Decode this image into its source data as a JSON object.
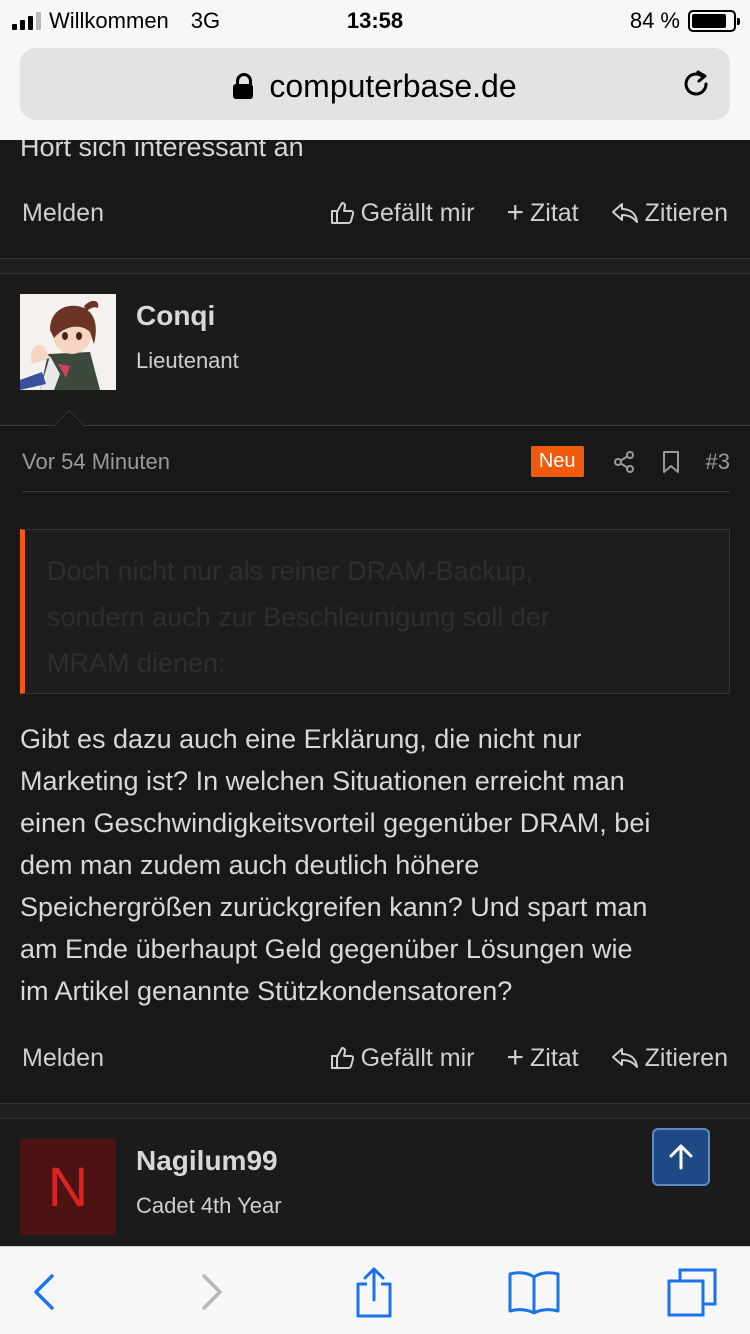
{
  "status_bar": {
    "carrier": "Willkommen",
    "network": "3G",
    "time": "13:58",
    "battery_text": "84 %",
    "battery_level": 0.84
  },
  "browser": {
    "url": "computerbase.de"
  },
  "previous_post": {
    "text_tail": "Hört sich interessant an",
    "actions": {
      "report": "Melden",
      "like": "Gefällt mir",
      "quote": "Zitat",
      "reply": "Zitieren"
    }
  },
  "post": {
    "author": "Conqi",
    "rank": "Lieutenant",
    "time": "Vor 54 Minuten",
    "badge": "Neu",
    "number": "#3",
    "quote_lines": [
      "Doch nicht nur als reiner DRAM-Backup,",
      "sondern auch zur Beschleunigung soll der",
      "MRAM dienen:"
    ],
    "body_lines": [
      "Gibt es dazu auch eine Erklärung, die nicht nur",
      "Marketing ist? In welchen Situationen erreicht man",
      "einen Geschwindigkeitsvorteil gegenüber DRAM, bei",
      "dem man zudem auch deutlich höhere",
      "Speichergrößen zurückgreifen kann? Und spart man",
      "am Ende überhaupt Geld gegenüber Lösungen wie",
      "im Artikel genannte Stützkondensatoren?"
    ],
    "actions": {
      "report": "Melden",
      "like": "Gefällt mir",
      "quote": "Zitat",
      "reply": "Zitieren"
    }
  },
  "next_post": {
    "author": "Nagilum99",
    "rank": "Cadet 4th Year",
    "avatar_letter": "N"
  },
  "colors": {
    "accent": "#f05a0e",
    "background": "#181818",
    "scroll_top": "#1d4a85",
    "ios_blue": "#1a73e8"
  },
  "toolbar_icons": [
    "back-icon",
    "forward-icon",
    "share-icon",
    "bookmarks-icon",
    "tabs-icon"
  ]
}
